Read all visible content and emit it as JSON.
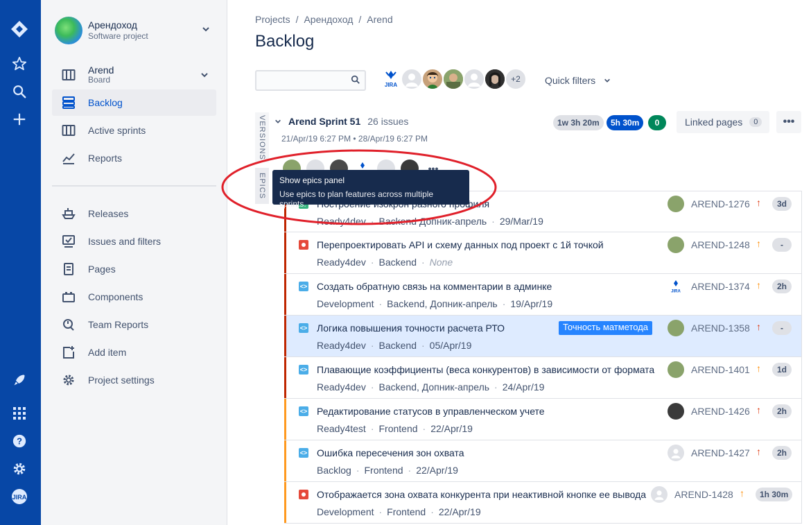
{
  "sidebar": {
    "project_name": "Арендоход",
    "project_type": "Software project",
    "board_name": "Arend",
    "board_type": "Board",
    "items": [
      {
        "label": "Backlog",
        "icon": "backlog-icon",
        "active": true
      },
      {
        "label": "Active sprints",
        "icon": "board-icon"
      },
      {
        "label": "Reports",
        "icon": "reports-icon"
      },
      {
        "label": "Releases",
        "icon": "ship-icon"
      },
      {
        "label": "Issues and filters",
        "icon": "issues-icon"
      },
      {
        "label": "Pages",
        "icon": "page-icon"
      },
      {
        "label": "Components",
        "icon": "components-icon"
      },
      {
        "label": "Team Reports",
        "icon": "team-reports-icon"
      },
      {
        "label": "Add item",
        "icon": "add-item-icon"
      },
      {
        "label": "Project settings",
        "icon": "settings-icon"
      }
    ]
  },
  "global_nav": {
    "icons": [
      "jira-logo-icon",
      "star-icon",
      "search-icon",
      "create-icon",
      "rocket-icon",
      "apps-icon",
      "help-icon",
      "settings-icon",
      "profile-avatar"
    ]
  },
  "breadcrumb": [
    "Projects",
    "/",
    "Арендоход",
    "/",
    "Arend"
  ],
  "page_title": "Backlog",
  "search": {
    "placeholder": ""
  },
  "avatars_more": "+2",
  "quick_filters": "Quick filters",
  "vertical_tabs": {
    "versions": "VERSIONS",
    "epics": "EPICS"
  },
  "sprint": {
    "name": "Arend Sprint 51",
    "issue_count": "26 issues",
    "dates": "21/Apr/19 6:27 PM • 28/Apr/19 6:27 PM",
    "estimates": [
      "1w 3h 20m",
      "5h 30m",
      "0"
    ],
    "linked_pages": "Linked pages",
    "linked_pages_count": "0",
    "more": "•••"
  },
  "tooltip": {
    "title": "Show epics panel",
    "body": "Use epics to plan features across multiple sprints."
  },
  "issues": [
    {
      "summary": "Построение изокрон разного профиля",
      "status": "Ready4dev",
      "components": "Backend",
      "version": "Допник-апрель",
      "date": "29/Mar/19",
      "key": "AREND-1276",
      "priority": "↑",
      "priority_color": "#de350b",
      "estimate": "3d",
      "type": "story",
      "epic_color": "#bf2600"
    },
    {
      "summary": "Перепроектировать API и схему данных под проект с 1й точкой",
      "status": "Ready4dev",
      "components": "Backend",
      "version": "None",
      "date": "",
      "key": "AREND-1248",
      "priority": "↑",
      "priority_color": "#ff8b00",
      "estimate": "-",
      "type": "bug",
      "epic_color": "#bf2600"
    },
    {
      "summary": "Создать обратную связь на комментарии в админке",
      "status": "Development",
      "components": "Backend, Допник-апрель",
      "version": "",
      "date": "19/Apr/19",
      "key": "AREND-1374",
      "priority": "↑",
      "priority_color": "#ff8b00",
      "estimate": "2h",
      "type": "task",
      "epic_color": "#bf2600"
    },
    {
      "summary": "Логика повышения точности расчета РТО",
      "status": "Ready4dev",
      "components": "Backend",
      "version": "",
      "date": "05/Apr/19",
      "key": "AREND-1358",
      "priority": "↑",
      "priority_color": "#de350b",
      "estimate": "-",
      "type": "task",
      "epic_color": "#bf2600",
      "epic": "Точность матметода",
      "selected": true
    },
    {
      "summary": "Плавающие коэффициенты (веса конкурентов) в зависимости от формата",
      "status": "Ready4dev",
      "components": "Backend, Допник-апрель",
      "version": "",
      "date": "24/Apr/19",
      "key": "AREND-1401",
      "priority": "↑",
      "priority_color": "#ff8b00",
      "estimate": "1d",
      "type": "task",
      "epic_color": "#bf2600"
    },
    {
      "summary": "Редактирование статусов в управленческом учете",
      "status": "Ready4test",
      "components": "Frontend",
      "version": "",
      "date": "22/Apr/19",
      "key": "AREND-1426",
      "priority": "↑",
      "priority_color": "#de350b",
      "estimate": "2h",
      "type": "task",
      "epic_color": "#ff991f"
    },
    {
      "summary": "Ошибка пересечения зон охвата",
      "status": "Backlog",
      "components": "Frontend",
      "version": "",
      "date": "22/Apr/19",
      "key": "AREND-1427",
      "priority": "↑",
      "priority_color": "#de350b",
      "estimate": "2h",
      "type": "task",
      "epic_color": "#ff991f"
    },
    {
      "summary": "Отображается зона охвата конкурента при неактивной кнопке ее вывода",
      "status": "Development",
      "components": "Frontend",
      "version": "",
      "date": "22/Apr/19",
      "key": "AREND-1428",
      "priority": "↑",
      "priority_color": "#ff8b00",
      "estimate": "1h 30m",
      "type": "bug",
      "epic_color": "#ff991f"
    }
  ]
}
